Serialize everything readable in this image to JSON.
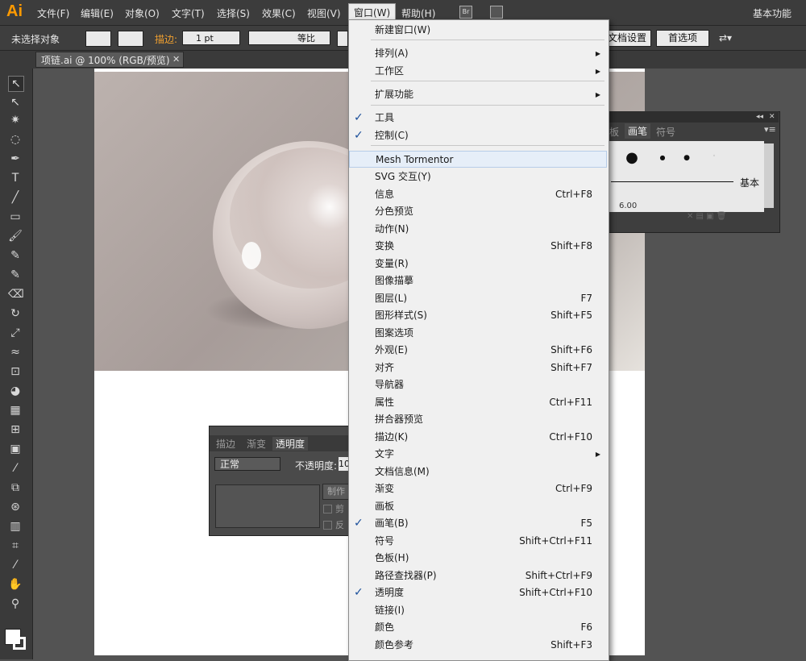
{
  "app": {
    "logo": "Ai",
    "workspace": "基本功能"
  },
  "menubar": [
    "文件(F)",
    "编辑(E)",
    "对象(O)",
    "文字(T)",
    "选择(S)",
    "效果(C)",
    "视图(V)",
    "窗口(W)",
    "帮助(H)"
  ],
  "menubar_extra": {
    "bridge": "Br"
  },
  "control": {
    "selection": "未选择对象",
    "stroke_label": "描边:",
    "stroke_weight": "1 pt",
    "profile": "等比",
    "doc_setup": "文档设置",
    "prefs": "首选项"
  },
  "document_tab": "项链.ai @ 100% (RGB/预览)",
  "transparency_panel": {
    "tabs": [
      "描边",
      "渐变",
      "透明度"
    ],
    "mode": "正常",
    "opacity_label": "不透明度:",
    "opacity_value": "10",
    "make_mask": "制作",
    "clip": "剪",
    "invert": "反"
  },
  "brush_panel": {
    "tabs": [
      "板",
      "画笔",
      "符号"
    ],
    "basic": "基本",
    "size": "6.00"
  },
  "window_menu": [
    {
      "label": "新建窗口(W)",
      "shortcut": "",
      "check": false,
      "sub": false
    },
    {
      "label": "排列(A)",
      "shortcut": "",
      "check": false,
      "sub": true
    },
    {
      "label": "工作区",
      "shortcut": "",
      "check": false,
      "sub": true
    },
    {
      "label": "扩展功能",
      "shortcut": "",
      "check": false,
      "sub": true
    },
    {
      "label": "工具",
      "shortcut": "",
      "check": true,
      "sub": false
    },
    {
      "label": "控制(C)",
      "shortcut": "",
      "check": true,
      "sub": false
    },
    {
      "label": "Mesh Tormentor",
      "shortcut": "",
      "check": false,
      "sub": false
    },
    {
      "label": "SVG 交互(Y)",
      "shortcut": "",
      "check": false,
      "sub": false
    },
    {
      "label": "信息",
      "shortcut": "Ctrl+F8",
      "check": false,
      "sub": false
    },
    {
      "label": "分色预览",
      "shortcut": "",
      "check": false,
      "sub": false
    },
    {
      "label": "动作(N)",
      "shortcut": "",
      "check": false,
      "sub": false
    },
    {
      "label": "变换",
      "shortcut": "Shift+F8",
      "check": false,
      "sub": false
    },
    {
      "label": "变量(R)",
      "shortcut": "",
      "check": false,
      "sub": false
    },
    {
      "label": "图像描摹",
      "shortcut": "",
      "check": false,
      "sub": false
    },
    {
      "label": "图层(L)",
      "shortcut": "F7",
      "check": false,
      "sub": false
    },
    {
      "label": "图形样式(S)",
      "shortcut": "Shift+F5",
      "check": false,
      "sub": false
    },
    {
      "label": "图案选项",
      "shortcut": "",
      "check": false,
      "sub": false
    },
    {
      "label": "外观(E)",
      "shortcut": "Shift+F6",
      "check": false,
      "sub": false
    },
    {
      "label": "对齐",
      "shortcut": "Shift+F7",
      "check": false,
      "sub": false
    },
    {
      "label": "导航器",
      "shortcut": "",
      "check": false,
      "sub": false
    },
    {
      "label": "属性",
      "shortcut": "Ctrl+F11",
      "check": false,
      "sub": false
    },
    {
      "label": "拼合器预览",
      "shortcut": "",
      "check": false,
      "sub": false
    },
    {
      "label": "描边(K)",
      "shortcut": "Ctrl+F10",
      "check": false,
      "sub": false
    },
    {
      "label": "文字",
      "shortcut": "",
      "check": false,
      "sub": true
    },
    {
      "label": "文档信息(M)",
      "shortcut": "",
      "check": false,
      "sub": false
    },
    {
      "label": "渐变",
      "shortcut": "Ctrl+F9",
      "check": false,
      "sub": false
    },
    {
      "label": "画板",
      "shortcut": "",
      "check": false,
      "sub": false
    },
    {
      "label": "画笔(B)",
      "shortcut": "F5",
      "check": true,
      "sub": false
    },
    {
      "label": "符号",
      "shortcut": "Shift+Ctrl+F11",
      "check": false,
      "sub": false
    },
    {
      "label": "色板(H)",
      "shortcut": "",
      "check": false,
      "sub": false
    },
    {
      "label": "路径查找器(P)",
      "shortcut": "Shift+Ctrl+F9",
      "check": false,
      "sub": false
    },
    {
      "label": "透明度",
      "shortcut": "Shift+Ctrl+F10",
      "check": true,
      "sub": false
    },
    {
      "label": "链接(I)",
      "shortcut": "",
      "check": false,
      "sub": false
    },
    {
      "label": "颜色",
      "shortcut": "F6",
      "check": false,
      "sub": false
    },
    {
      "label": "颜色参考",
      "shortcut": "Shift+F3",
      "check": false,
      "sub": false
    }
  ]
}
